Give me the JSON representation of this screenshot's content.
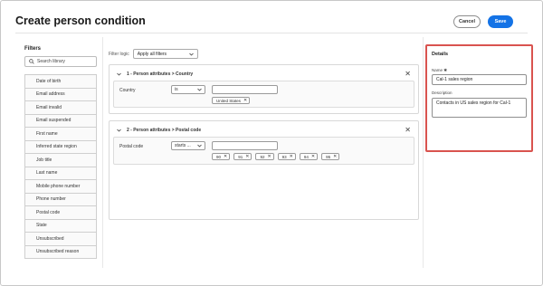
{
  "header": {
    "title": "Create person condition",
    "cancel_label": "Cancel",
    "save_label": "Save"
  },
  "filters": {
    "title": "Filters",
    "search_placeholder": "Search library",
    "items": [
      {
        "label": "Date of birth"
      },
      {
        "label": "Email address"
      },
      {
        "label": "Email invalid"
      },
      {
        "label": "Email suspended"
      },
      {
        "label": "First name"
      },
      {
        "label": "Inferred state region"
      },
      {
        "label": "Job title"
      },
      {
        "label": "Last name"
      },
      {
        "label": "Mobile phone number"
      },
      {
        "label": "Phone number"
      },
      {
        "label": "Postal code"
      },
      {
        "label": "State"
      },
      {
        "label": "Unsubscribed"
      },
      {
        "label": "Unsubscribed reason"
      }
    ]
  },
  "logic": {
    "label": "Filter logic",
    "value": "Apply all filters"
  },
  "conditions": [
    {
      "title": "1 - Person attributes > Country",
      "field_label": "Country",
      "operator": "is",
      "tags": [
        "United States"
      ]
    },
    {
      "title": "2 - Person attributes > Postal code",
      "field_label": "Postal code",
      "operator": "starts ...",
      "tags": [
        "90",
        "91",
        "92",
        "93",
        "94",
        "95"
      ]
    }
  ],
  "details": {
    "title": "Details",
    "name_label": "Name",
    "name_value": "Cal-1 sales region",
    "description_label": "Description",
    "description_value": "Contacts in US sales region for Cal-1"
  },
  "colors": {
    "accent": "#1473e6",
    "highlight_border": "#d9534f"
  },
  "icons": {
    "search": "search-icon",
    "chevron": "chevron-down-icon",
    "close": "close-icon"
  }
}
